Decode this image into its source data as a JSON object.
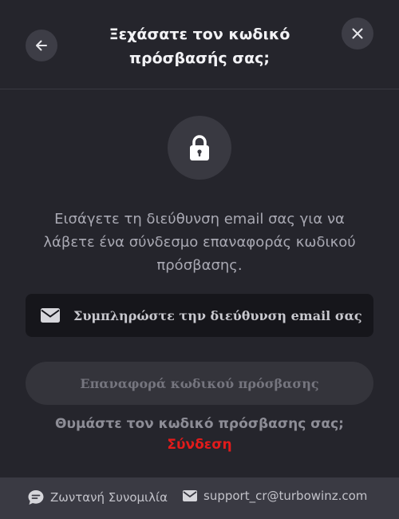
{
  "header": {
    "title_line1": "Ξεχάσατε τον κωδικό",
    "title_line2": "πρόσβασής σας;",
    "back_icon": "arrow-left-icon",
    "close_icon": "close-icon"
  },
  "main": {
    "lock_icon": "lock-icon",
    "description": "Εισάγετε τη διεύθυνση email σας για να λάβετε ένα σύνδεσμο επαναφοράς κωδικού πρόσβασης.",
    "email_field": {
      "icon": "envelope-icon",
      "placeholder": "Συμπληρώστε την διεύθυνση email σας",
      "value": ""
    },
    "reset_button_label": "Επαναφορά κωδικού πρόσβασης",
    "remember_text": "Θυμάστε τον κωδικό πρόσβασης σας;",
    "login_link": "Σύνδεση"
  },
  "footer": {
    "chat_label": "Ζωντανή Συνομιλία",
    "chat_icon": "chat-bubble-icon",
    "email_label": "support_cr@turbowinz.com",
    "email_icon": "envelope-icon"
  },
  "colors": {
    "background": "#25252c",
    "input_background": "#16161b",
    "button_disabled": "#34343b",
    "link_red": "#e21b1b",
    "footer_background": "#3a3a43"
  }
}
